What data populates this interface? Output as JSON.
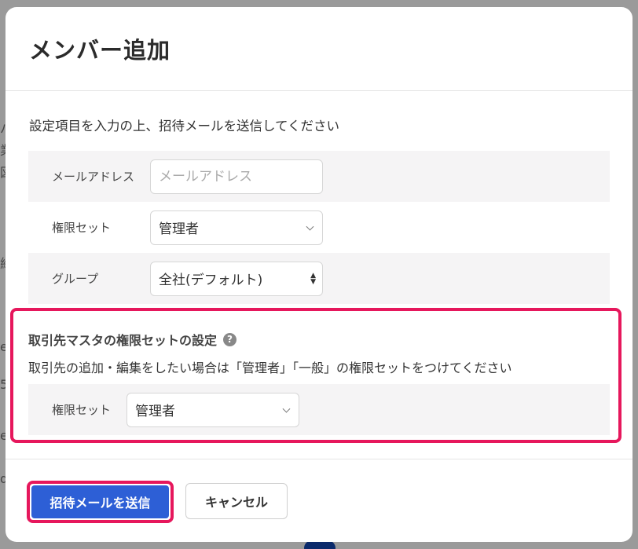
{
  "background": {
    "fragments": [
      "バ",
      "業",
      "図",
      "維",
      "e",
      "5",
      "er",
      "d"
    ]
  },
  "modal": {
    "title": "メンバー追加",
    "intro": "設定項目を入力の上、招待メールを送信してください",
    "fields": {
      "email": {
        "label": "メールアドレス",
        "placeholder": "メールアドレス",
        "value": ""
      },
      "permission": {
        "label": "権限セット",
        "value": "管理者"
      },
      "group": {
        "label": "グループ",
        "value": "全社(デフォルト)"
      }
    },
    "client_master": {
      "title": "取引先マスタの権限セットの設定",
      "help_icon": "question-circle-icon",
      "description": "取引先の追加・編集をしたい場合は「管理者」「一般」の権限セットをつけてください",
      "permission": {
        "label": "権限セット",
        "value": "管理者"
      }
    },
    "footer": {
      "submit_label": "招待メールを送信",
      "cancel_label": "キャンセル"
    }
  },
  "colors": {
    "primary": "#2d5fd6",
    "highlight": "#e6175c",
    "row_shade": "#f5f4f5"
  }
}
